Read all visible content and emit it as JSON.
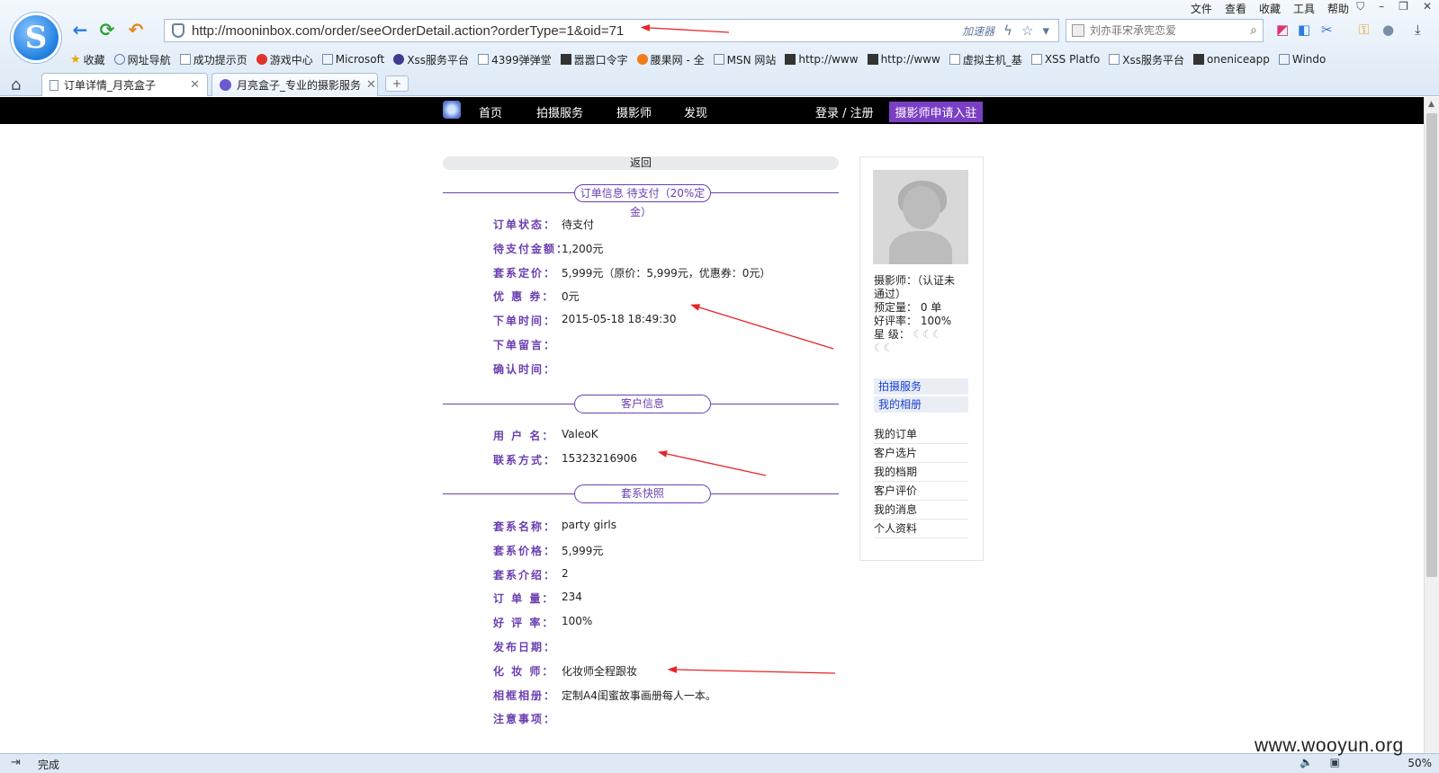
{
  "browser": {
    "address_url": "http://mooninbox.com/order/seeOrderDetail.action?orderType=1&oid=71",
    "accelerator_label": "加速器",
    "search_placeholder": "刘亦菲宋承宪恋爱",
    "menu": [
      "文件",
      "查看",
      "收藏",
      "工具",
      "帮助"
    ],
    "bookmarks": [
      {
        "label": "收藏",
        "icon": "star-icon"
      },
      {
        "label": "网址导航",
        "icon": "globe-icon"
      },
      {
        "label": "成功提示页",
        "icon": "page-icon"
      },
      {
        "label": "游戏中心",
        "icon": "game-icon"
      },
      {
        "label": "Microsoft",
        "icon": "folder-icon"
      },
      {
        "label": "Xss服务平台",
        "icon": "xss-icon"
      },
      {
        "label": "4399弹弹堂",
        "icon": "page-icon"
      },
      {
        "label": "嚣嚣口令字",
        "icon": "image-icon"
      },
      {
        "label": "腰果网 - 全",
        "icon": "orange-icon"
      },
      {
        "label": "MSN 网站",
        "icon": "folder-icon"
      },
      {
        "label": "http://www",
        "icon": "image-icon"
      },
      {
        "label": "http://www",
        "icon": "image-icon"
      },
      {
        "label": "虚拟主机_基",
        "icon": "page-icon"
      },
      {
        "label": "XSS Platfo",
        "icon": "page-icon"
      },
      {
        "label": "Xss服务平台",
        "icon": "page-icon"
      },
      {
        "label": "oneniceapp",
        "icon": "image-icon"
      },
      {
        "label": "Windo",
        "icon": "folder-icon"
      }
    ],
    "tabs": [
      {
        "title": "订单详情_月亮盒子"
      },
      {
        "title": "月亮盒子_专业的摄影服务"
      }
    ],
    "status_text": "完成",
    "zoom": "50%"
  },
  "site_nav": {
    "home": "首页",
    "service": "拍摄服务",
    "photographer": "摄影师",
    "discover": "发现",
    "login": "登录 / 注册",
    "apply": "摄影师申请入驻"
  },
  "page": {
    "back_label": "返回",
    "order_section": {
      "title_line1": "订单信息   待支付（20%定",
      "title_line2": "金）",
      "fields": [
        {
          "label": "订单状态：",
          "value": "待支付"
        },
        {
          "label": "待支付金额：",
          "value": "1,200元"
        },
        {
          "label": "套系定价：",
          "value": "5,999元（原价：5,999元，优惠券：0元）"
        },
        {
          "label": "优 惠 券：",
          "value": "0元"
        },
        {
          "label": "下单时间：",
          "value": "2015-05-18 18:49:30"
        },
        {
          "label": "下单留言：",
          "value": ""
        },
        {
          "label": "确认时间：",
          "value": ""
        }
      ]
    },
    "customer_section": {
      "title": "客户信息",
      "fields": [
        {
          "label": "用 户 名：",
          "value": "ValeoK"
        },
        {
          "label": "联系方式：",
          "value": "15323216906"
        }
      ]
    },
    "package_section": {
      "title": "套系快照",
      "fields": [
        {
          "label": "套系名称：",
          "value": "party girls"
        },
        {
          "label": "套系价格：",
          "value": "5,999元"
        },
        {
          "label": "套系介绍：",
          "value": "2"
        },
        {
          "label": "订 单 量：",
          "value": "234"
        },
        {
          "label": "好 评 率：",
          "value": "100%"
        },
        {
          "label": "发布日期：",
          "value": ""
        },
        {
          "label": "化 妆 师：",
          "value": "化妆师全程跟妆"
        },
        {
          "label": "相框相册：",
          "value": "定制A4闺蜜故事画册每人一本。"
        },
        {
          "label": "注意事项：",
          "value": ""
        }
      ]
    }
  },
  "sidebar": {
    "photographer_line1": "摄影师：（认证未",
    "photographer_line2": "通过）",
    "bookings": "预定量： 0 单",
    "rating": "好评率： 100%",
    "level_label": "星    级：",
    "links": [
      "拍摄服务",
      "我的相册"
    ],
    "menu": [
      "我的订单",
      "客户选片",
      "我的档期",
      "客户评价",
      "我的消息",
      "个人资料"
    ]
  },
  "watermark": "www.wooyun.org",
  "colors": {
    "accent": "#6b3fb0",
    "apply_button": "#7a3fc4",
    "annotation_arrow": "#e8242b"
  }
}
